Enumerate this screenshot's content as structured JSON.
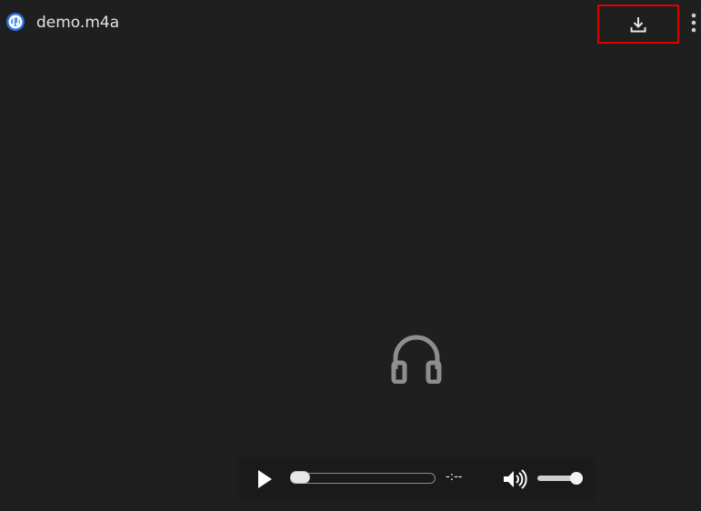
{
  "header": {
    "title": "demo.m4a",
    "file_icon": "audio-file-icon",
    "download_icon": "download-icon",
    "more_icon": "more-vertical-icon"
  },
  "media": {
    "placeholder_icon": "headphones-icon"
  },
  "controls": {
    "play_icon": "play-icon",
    "progress": 0,
    "time": "-:--",
    "volume_icon": "volume-icon",
    "volume_level": 1
  },
  "colors": {
    "background": "#1f1f1f",
    "highlight_border": "#e00000",
    "icon_gray": "#8e8e8e",
    "text": "#e3e3e3"
  }
}
